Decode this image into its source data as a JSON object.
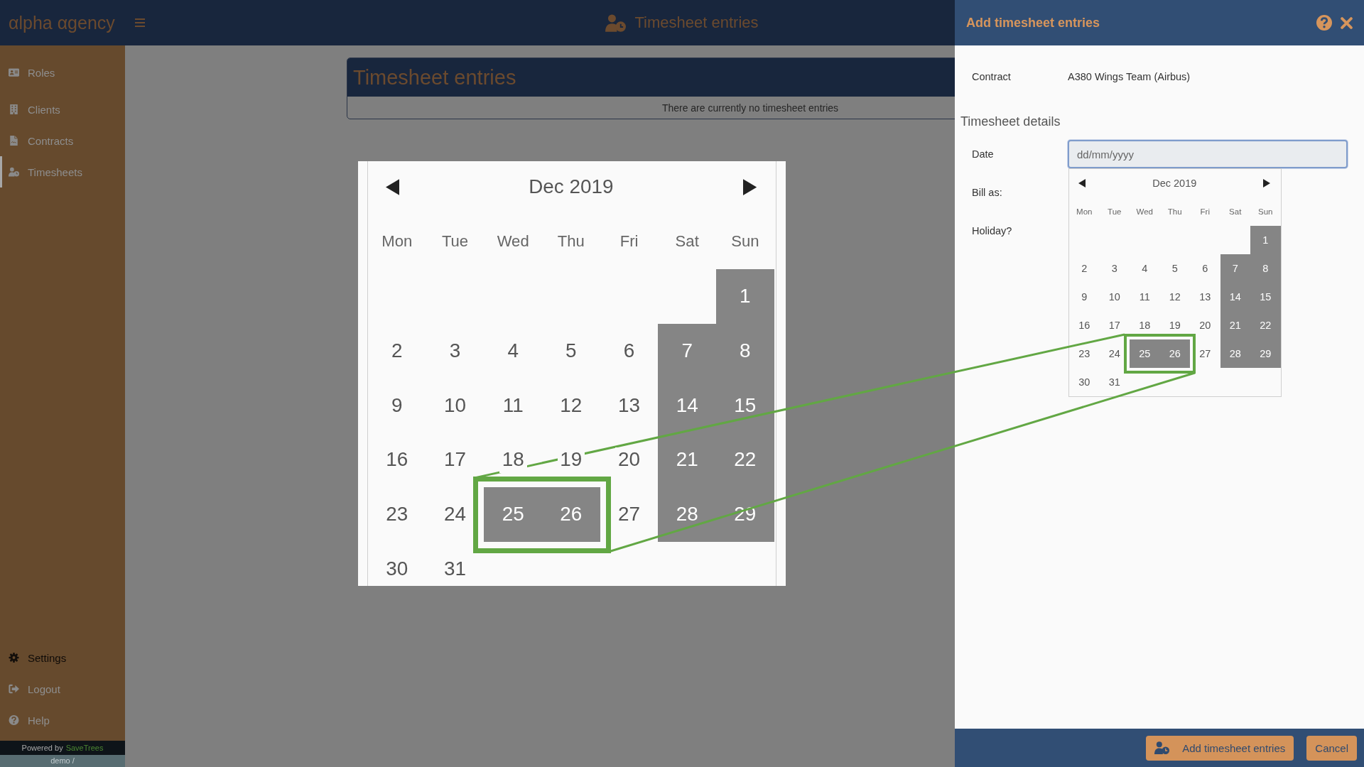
{
  "top_bar": {
    "logo": "αlpha αgency",
    "title": "Timesheet entries"
  },
  "sidebar": {
    "items": [
      {
        "label": "Roles",
        "selected": false,
        "disabled": false
      },
      {
        "label": "Clients",
        "selected": false,
        "disabled": false
      },
      {
        "label": "Contracts",
        "selected": false,
        "disabled": false
      },
      {
        "label": "Timesheets",
        "selected": true,
        "disabled": false
      }
    ],
    "bottom_items": [
      {
        "label": "Settings",
        "selected": false,
        "disabled": true
      },
      {
        "label": "Logout",
        "selected": false,
        "disabled": false
      },
      {
        "label": "Help",
        "selected": false,
        "disabled": false
      }
    ],
    "footer": {
      "powered_by": "Powered by",
      "brand": "SaveTrees",
      "environment": "demo /"
    }
  },
  "page": {
    "panel_title": "Timesheet entries",
    "empty_message": "There are currently no timesheet entries"
  },
  "drawer": {
    "title": "Add timesheet entries",
    "contract": {
      "label": "Contract",
      "value": "A380 Wings Team (Airbus)"
    },
    "section_title": "Timesheet details",
    "fields": [
      {
        "kind": "date",
        "label": "Date",
        "placeholder": "dd/mm/yyyy"
      },
      {
        "kind": "plain",
        "label": "Bill as:"
      },
      {
        "kind": "plain",
        "label": "Holiday?"
      }
    ],
    "buttons": [
      {
        "kind": "primary",
        "label": "Add timesheet entries"
      },
      {
        "kind": "secondary",
        "label": "Cancel"
      }
    ]
  },
  "date_picker": {
    "month": "Dec 2019",
    "weekdays": [
      "Mon",
      "Tue",
      "Wed",
      "Thu",
      "Fri",
      "Sat",
      "Sun"
    ],
    "weeks": [
      [
        {
          "day": "1",
          "disabled": true,
          "marked": false
        }
      ],
      [
        {
          "day": "2",
          "disabled": false,
          "marked": false
        },
        {
          "day": "3",
          "disabled": false,
          "marked": false
        },
        {
          "day": "4",
          "disabled": false,
          "marked": false
        },
        {
          "day": "5",
          "disabled": false,
          "marked": false
        },
        {
          "day": "6",
          "disabled": false,
          "marked": false
        },
        {
          "day": "7",
          "disabled": true,
          "marked": false
        },
        {
          "day": "8",
          "disabled": true,
          "marked": false
        }
      ],
      [
        {
          "day": "9",
          "disabled": false,
          "marked": false
        },
        {
          "day": "10",
          "disabled": false,
          "marked": false
        },
        {
          "day": "11",
          "disabled": false,
          "marked": false
        },
        {
          "day": "12",
          "disabled": false,
          "marked": false
        },
        {
          "day": "13",
          "disabled": false,
          "marked": false
        },
        {
          "day": "14",
          "disabled": true,
          "marked": false
        },
        {
          "day": "15",
          "disabled": true,
          "marked": false
        }
      ],
      [
        {
          "day": "16",
          "disabled": false,
          "marked": false
        },
        {
          "day": "17",
          "disabled": false,
          "marked": false
        },
        {
          "day": "18",
          "disabled": false,
          "marked": false
        },
        {
          "day": "19",
          "disabled": false,
          "marked": false
        },
        {
          "day": "20",
          "disabled": false,
          "marked": false
        },
        {
          "day": "21",
          "disabled": true,
          "marked": false
        },
        {
          "day": "22",
          "disabled": true,
          "marked": false
        }
      ],
      [
        {
          "day": "23",
          "disabled": false,
          "marked": false
        },
        {
          "day": "24",
          "disabled": false,
          "marked": false
        },
        {
          "day": "25",
          "disabled": true,
          "marked": true
        },
        {
          "day": "26",
          "disabled": true,
          "marked": true
        },
        {
          "day": "27",
          "disabled": false,
          "marked": false
        },
        {
          "day": "28",
          "disabled": true,
          "marked": false
        },
        {
          "day": "29",
          "disabled": true,
          "marked": false
        }
      ],
      [
        {
          "day": "30",
          "disabled": false,
          "marked": false
        },
        {
          "day": "31",
          "disabled": false,
          "marked": false
        }
      ]
    ]
  },
  "magnified_picker": {
    "month": "Dec 2019",
    "weekdays": [
      "Mon",
      "Tue",
      "Wed",
      "Thu",
      "Fri",
      "Sat",
      "Sun"
    ],
    "weeks": [
      [
        {
          "day": "1",
          "disabled": true,
          "marked": false
        }
      ],
      [
        {
          "day": "2",
          "disabled": false,
          "marked": false
        },
        {
          "day": "3",
          "disabled": false,
          "marked": false
        },
        {
          "day": "4",
          "disabled": false,
          "marked": false
        },
        {
          "day": "5",
          "disabled": false,
          "marked": false
        },
        {
          "day": "6",
          "disabled": false,
          "marked": false
        },
        {
          "day": "7",
          "disabled": true,
          "marked": false
        },
        {
          "day": "8",
          "disabled": true,
          "marked": false
        }
      ],
      [
        {
          "day": "9",
          "disabled": false,
          "marked": false
        },
        {
          "day": "10",
          "disabled": false,
          "marked": false
        },
        {
          "day": "11",
          "disabled": false,
          "marked": false
        },
        {
          "day": "12",
          "disabled": false,
          "marked": false
        },
        {
          "day": "13",
          "disabled": false,
          "marked": false
        },
        {
          "day": "14",
          "disabled": true,
          "marked": false
        },
        {
          "day": "15",
          "disabled": true,
          "marked": false
        }
      ],
      [
        {
          "day": "16",
          "disabled": false,
          "marked": false
        },
        {
          "day": "17",
          "disabled": false,
          "marked": false
        },
        {
          "day": "18",
          "disabled": false,
          "marked": false
        },
        {
          "day": "19",
          "disabled": false,
          "marked": false
        },
        {
          "day": "20",
          "disabled": false,
          "marked": false
        },
        {
          "day": "21",
          "disabled": true,
          "marked": false
        },
        {
          "day": "22",
          "disabled": true,
          "marked": false
        }
      ],
      [
        {
          "day": "23",
          "disabled": false,
          "marked": false
        },
        {
          "day": "24",
          "disabled": false,
          "marked": false
        },
        {
          "day": "25",
          "disabled": true,
          "marked": true
        },
        {
          "day": "26",
          "disabled": true,
          "marked": true
        },
        {
          "day": "27",
          "disabled": false,
          "marked": false
        },
        {
          "day": "28",
          "disabled": true,
          "marked": false
        },
        {
          "day": "29",
          "disabled": true,
          "marked": false
        }
      ],
      [
        {
          "day": "30",
          "disabled": false,
          "marked": false
        },
        {
          "day": "31",
          "disabled": false,
          "marked": false
        }
      ]
    ]
  }
}
